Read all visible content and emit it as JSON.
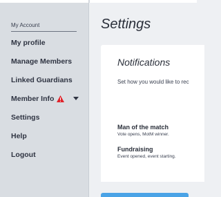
{
  "sidebar": {
    "title": "My Account",
    "items": [
      {
        "label": "My profile"
      },
      {
        "label": "Manage Members"
      },
      {
        "label": "Linked Guardians"
      },
      {
        "label": "Member Info"
      },
      {
        "label": "Settings"
      },
      {
        "label": "Help"
      },
      {
        "label": "Logout"
      }
    ],
    "alert_color": "#e0232b"
  },
  "main": {
    "title": "Settings",
    "notifications": {
      "heading": "Notifications",
      "description": "Set how you would like to rec",
      "options": [
        {
          "title": "Man of the match",
          "subtitle": "Vote opens, MotM winner."
        },
        {
          "title": "Fundraising",
          "subtitle": "Event opened, event starting."
        }
      ]
    },
    "accent_color": "#4aa3e6"
  }
}
